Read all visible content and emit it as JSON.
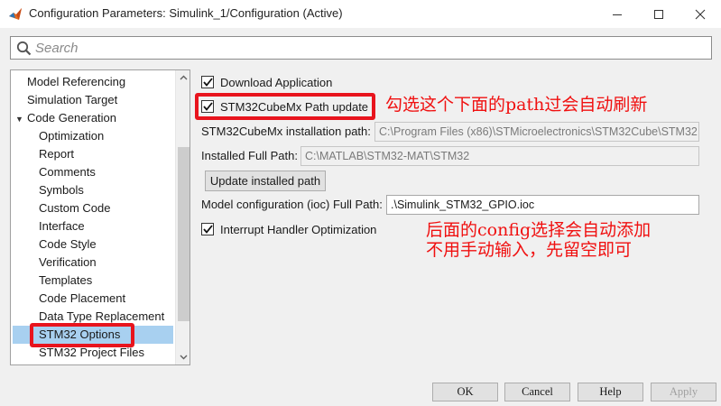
{
  "window": {
    "title": "Configuration Parameters: Simulink_1/Configuration (Active)",
    "icon": "matlab-icon"
  },
  "search": {
    "placeholder": "Search",
    "value": ""
  },
  "tree": {
    "items": [
      {
        "label": "Model Referencing",
        "level": 0
      },
      {
        "label": "Simulation Target",
        "level": 0
      },
      {
        "label": "Code Generation",
        "level": 0,
        "expanded": true
      },
      {
        "label": "Optimization",
        "level": 1
      },
      {
        "label": "Report",
        "level": 1
      },
      {
        "label": "Comments",
        "level": 1
      },
      {
        "label": "Symbols",
        "level": 1
      },
      {
        "label": "Custom Code",
        "level": 1
      },
      {
        "label": "Interface",
        "level": 1
      },
      {
        "label": "Code Style",
        "level": 1
      },
      {
        "label": "Verification",
        "level": 1
      },
      {
        "label": "Templates",
        "level": 1
      },
      {
        "label": "Code Placement",
        "level": 1
      },
      {
        "label": "Data Type Replacement",
        "level": 1
      },
      {
        "label": "STM32 Options",
        "level": 1,
        "selected": true
      },
      {
        "label": "STM32 Project Files",
        "level": 1
      }
    ]
  },
  "panel": {
    "download_app": {
      "label": "Download Application",
      "checked": true
    },
    "cubemx_path_update": {
      "label": "STM32CubeMx Path update",
      "checked": true
    },
    "cubemx_install_path": {
      "label": "STM32CubeMx installation path:",
      "value": "C:\\Program Files (x86)\\STMicroelectronics\\STM32Cube\\STM32"
    },
    "installed_full_path": {
      "label": "Installed Full Path:",
      "value": "C:\\MATLAB\\STM32-MAT\\STM32"
    },
    "update_button": "Update installed path",
    "model_config": {
      "label": "Model configuration (ioc) Full Path:",
      "value": ".\\Simulink_STM32_GPIO.ioc"
    },
    "interrupt_opt": {
      "label": "Interrupt Handler Optimization",
      "checked": true
    }
  },
  "annotations": {
    "note1": "勾选这个下面的path过会自动刷新",
    "note2_line1": "后面的config选择会自动添加",
    "note2_line2": "不用手动输入，先留空即可",
    "highlight_color": "#e8141d"
  },
  "buttons": {
    "ok": "OK",
    "cancel": "Cancel",
    "help": "Help",
    "apply": "Apply"
  }
}
